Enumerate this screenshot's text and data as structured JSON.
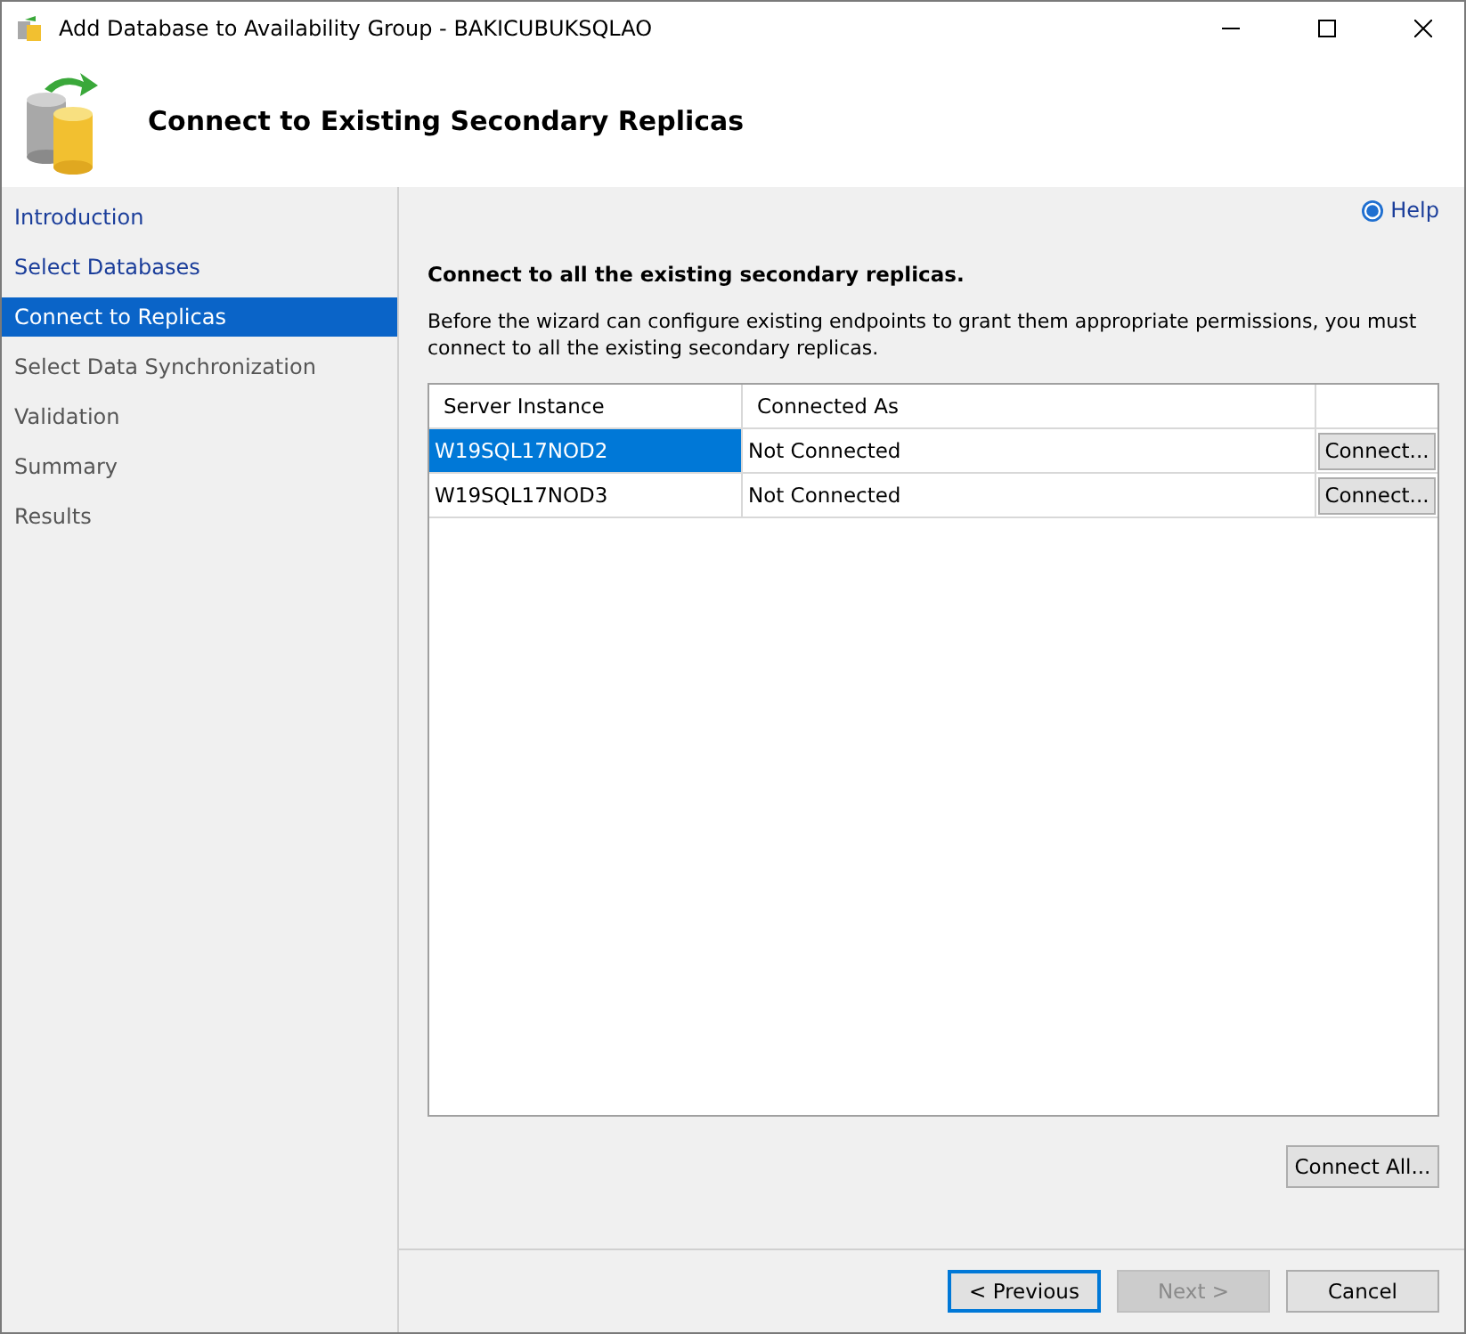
{
  "window": {
    "title": "Add Database to Availability Group - BAKICUBUKSQLAO"
  },
  "header": {
    "title": "Connect to Existing Secondary Replicas"
  },
  "sidebar": {
    "items": [
      {
        "label": "Introduction",
        "selected": false,
        "disabled": false
      },
      {
        "label": "Select Databases",
        "selected": false,
        "disabled": false
      },
      {
        "label": "Connect to Replicas",
        "selected": true,
        "disabled": false
      },
      {
        "label": "Select Data Synchronization",
        "selected": false,
        "disabled": true
      },
      {
        "label": "Validation",
        "selected": false,
        "disabled": true
      },
      {
        "label": "Summary",
        "selected": false,
        "disabled": true
      },
      {
        "label": "Results",
        "selected": false,
        "disabled": true
      }
    ]
  },
  "help": "Help",
  "heading": "Connect to all the existing secondary replicas.",
  "description": "Before the wizard can configure existing endpoints to grant them appropriate permissions, you must connect to all the existing secondary replicas.",
  "table": {
    "columns": [
      "Server Instance",
      "Connected As"
    ],
    "rows": [
      {
        "server": "W19SQL17NOD2",
        "connected_as": "Not Connected",
        "button": "Connect...",
        "selected": true
      },
      {
        "server": "W19SQL17NOD3",
        "connected_as": "Not Connected",
        "button": "Connect...",
        "selected": false
      }
    ]
  },
  "connect_all": "Connect All...",
  "buttons": [
    {
      "label": "< Previous",
      "disabled": false,
      "focused": true
    },
    {
      "label": "Next >",
      "disabled": true,
      "focused": false
    },
    {
      "label": "Cancel",
      "disabled": false,
      "focused": false
    }
  ]
}
